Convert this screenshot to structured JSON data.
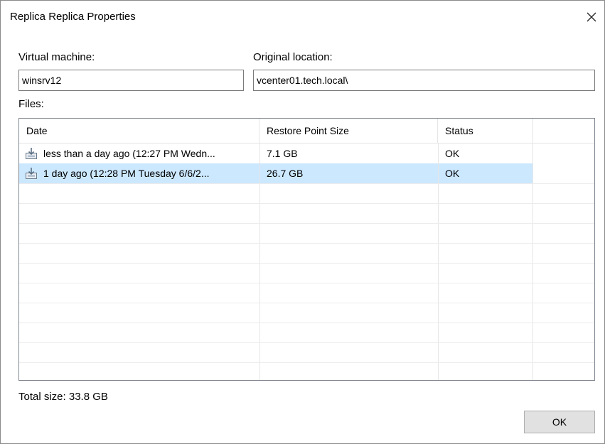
{
  "window": {
    "title": "Replica Replica Properties"
  },
  "fields": {
    "vm_label": "Virtual machine:",
    "vm_value": "winsrv12",
    "location_label": "Original location:",
    "location_value": "vcenter01.tech.local\\"
  },
  "files": {
    "label": "Files:",
    "columns": [
      "Date",
      "Restore Point Size",
      "Status"
    ],
    "rows": [
      {
        "icon": "restore-point-icon",
        "date": "less than a day ago (12:27 PM Wedn...",
        "size": "7.1 GB",
        "status": "OK",
        "selected": false
      },
      {
        "icon": "restore-point-icon",
        "date": "1 day ago (12:28 PM Tuesday 6/6/2...",
        "size": "26.7 GB",
        "status": "OK",
        "selected": true
      }
    ]
  },
  "footer": {
    "total_size": "Total size: 33.8 GB",
    "ok_label": "OK"
  },
  "colors": {
    "selection": "#cce8ff",
    "border": "#828790",
    "button_bg": "#e1e1e1"
  }
}
